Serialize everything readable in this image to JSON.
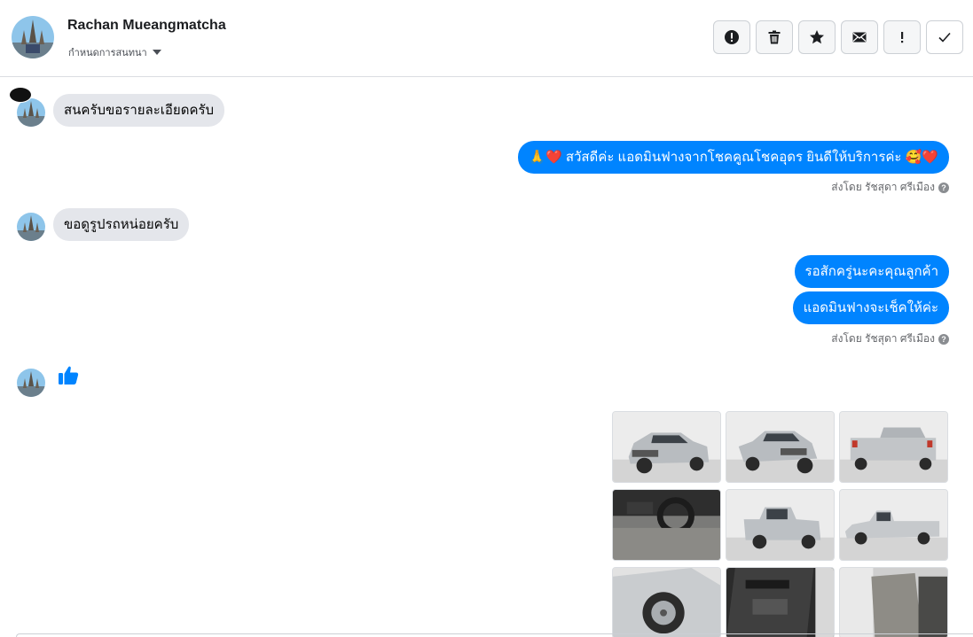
{
  "header": {
    "contact_name": "Rachan Mueangmatcha",
    "assign_label": "กำหนดการสนทนา"
  },
  "toolbar": {
    "buttons": [
      "report-icon",
      "trash-icon",
      "star-icon",
      "envelope-icon",
      "exclamation-icon",
      "check-icon"
    ]
  },
  "messages": {
    "m1": "สนครับขอรายละเอียดครับ",
    "m2": "🙏❤️ สวัสดีค่ะ แอดมินฟางจากโชคคูณโชคอุดร ยินดีให้บริการค่ะ 🥰❤️",
    "m2_sent_by": "ส่งโดย รัชสุดา ศรีเมือง",
    "m3": "ขอดูรูปรถหน่อยครับ",
    "m4": "รอสักครู่นะคะคุณลูกค้า",
    "m5": "แอดมินฟางจะเช็คให้ค่ะ",
    "m5_sent_by": "ส่งโดย รัชสุดา ศรีเมือง"
  },
  "colors": {
    "outgoing_bubble": "#0084ff",
    "incoming_bubble": "#e4e6eb",
    "like": "#0084ff"
  },
  "photos": [
    "car-front-left",
    "car-front-right",
    "car-rear",
    "car-interior-dashboard",
    "car-rear-right",
    "car-side",
    "car-wheel",
    "car-door-panel",
    "car-seats"
  ]
}
